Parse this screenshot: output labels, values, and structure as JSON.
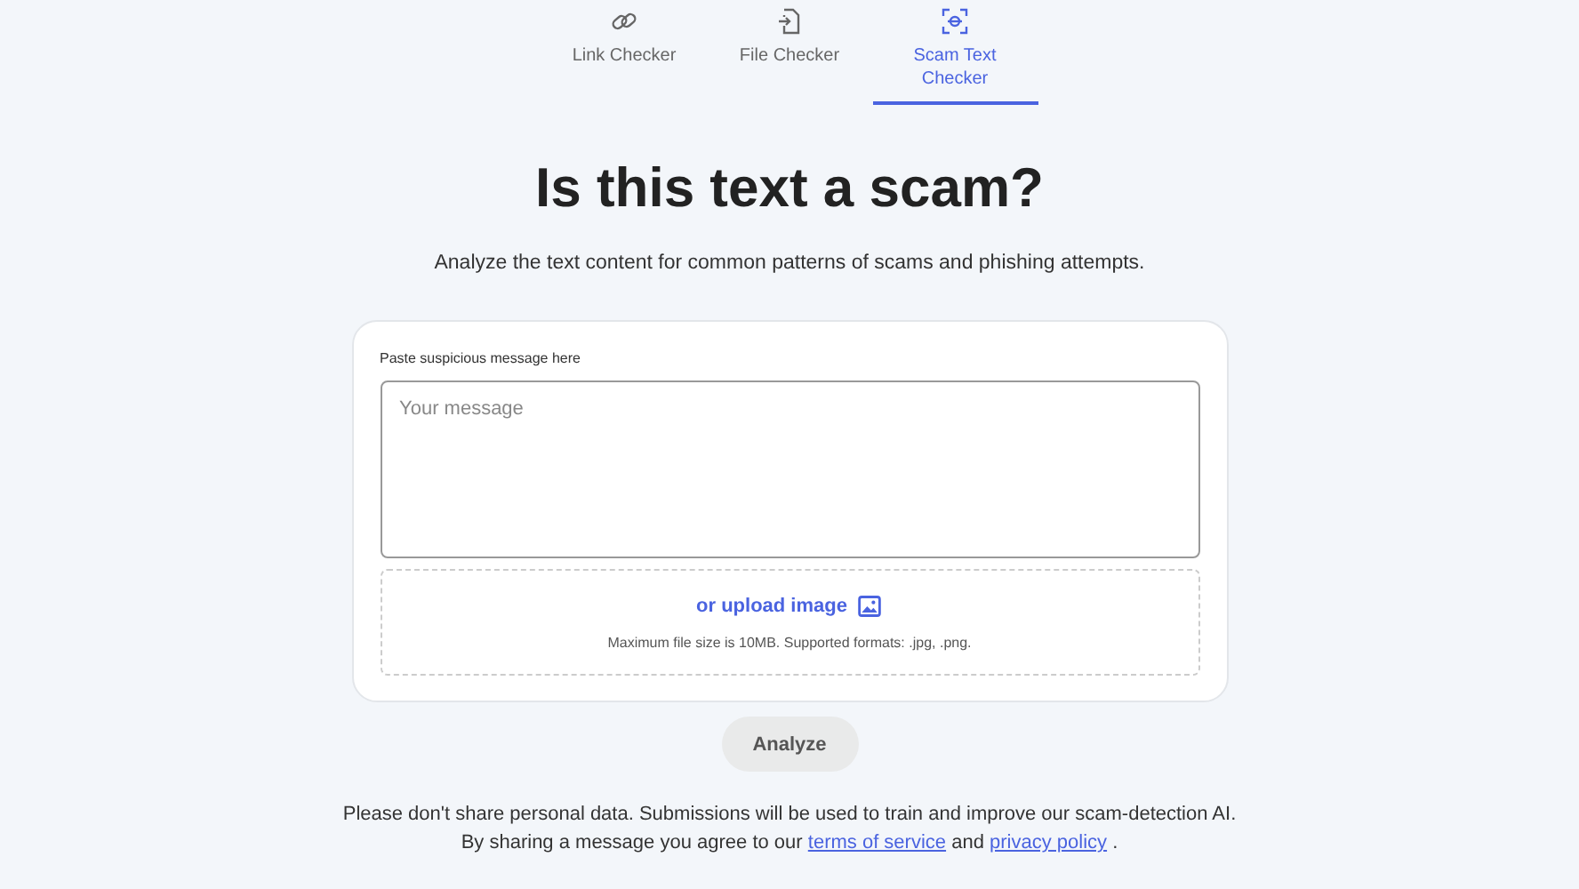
{
  "tabs": [
    {
      "label": "Link Checker",
      "kind": "link",
      "selected": false
    },
    {
      "label": "File Checker",
      "kind": "file",
      "selected": false
    },
    {
      "label": "Scam Text Checker",
      "kind": "scan",
      "selected": true
    }
  ],
  "title": "Is this text a scam?",
  "subtitle": "Analyze the text content for common patterns of scams and phishing attempts.",
  "form": {
    "label": "Paste suspicious message here",
    "placeholder": "Your message",
    "upload_link": "or upload image",
    "upload_hint": "Maximum file size is 10MB. Supported formats: .jpg, .png."
  },
  "analyze_button": {
    "label": "Analyze",
    "disabled": true
  },
  "footer": {
    "notice": "Please don't share personal data. Submissions will be used to train and improve our scam-detection AI.",
    "consent": {
      "text_1": "By sharing a message you agree to our",
      "link_1": "terms of service",
      "text_2": "and",
      "link_2": "privacy policy",
      "text_3": "."
    }
  }
}
